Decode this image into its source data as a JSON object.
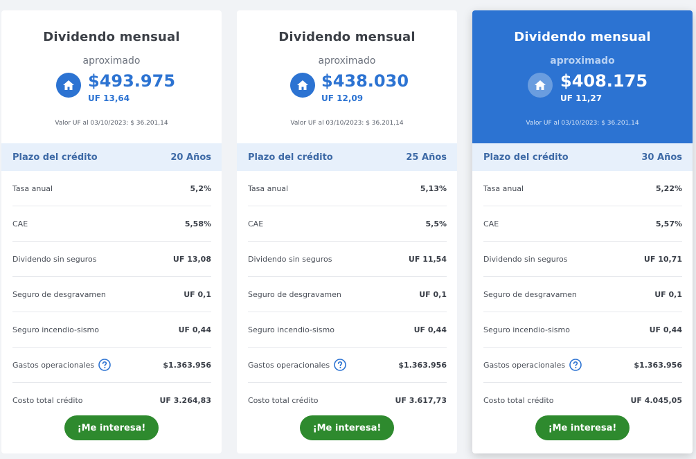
{
  "cards": [
    {
      "title": "Dividendo mensual",
      "subtitle": "aproximado",
      "amount": "$493.975",
      "amount_uf": "UF 13,64",
      "uf_note": "Valor UF al 03/10/2023: $ 36.201,14",
      "plazo_label": "Plazo del crédito",
      "plazo_value": "20 Años",
      "rows": [
        {
          "label": "Tasa anual",
          "value": "5,2%"
        },
        {
          "label": "CAE",
          "value": "5,58%"
        },
        {
          "label": "Dividendo sin seguros",
          "value": "UF 13,08"
        },
        {
          "label": "Seguro de desgravamen",
          "value": "UF 0,1"
        },
        {
          "label": "Seguro incendio-sismo",
          "value": "UF 0,44"
        },
        {
          "label": "Gastos operacionales",
          "value": "$1.363.956"
        },
        {
          "label": "Costo total crédito",
          "value": "UF 3.264,83"
        }
      ],
      "cta": "¡Me interesa!"
    },
    {
      "title": "Dividendo mensual",
      "subtitle": "aproximado",
      "amount": "$438.030",
      "amount_uf": "UF 12,09",
      "uf_note": "Valor UF al 03/10/2023: $ 36.201,14",
      "plazo_label": "Plazo del crédito",
      "plazo_value": "25 Años",
      "rows": [
        {
          "label": "Tasa anual",
          "value": "5,13%"
        },
        {
          "label": "CAE",
          "value": "5,5%"
        },
        {
          "label": "Dividendo sin seguros",
          "value": "UF 11,54"
        },
        {
          "label": "Seguro de desgravamen",
          "value": "UF 0,1"
        },
        {
          "label": "Seguro incendio-sismo",
          "value": "UF 0,44"
        },
        {
          "label": "Gastos operacionales",
          "value": "$1.363.956"
        },
        {
          "label": "Costo total crédito",
          "value": "UF 3.617,73"
        }
      ],
      "cta": "¡Me interesa!"
    },
    {
      "title": "Dividendo mensual",
      "subtitle": "aproximado",
      "amount": "$408.175",
      "amount_uf": "UF 11,27",
      "uf_note": "Valor UF al 03/10/2023: $ 36.201,14",
      "plazo_label": "Plazo del crédito",
      "plazo_value": "30 Años",
      "rows": [
        {
          "label": "Tasa anual",
          "value": "5,22%"
        },
        {
          "label": "CAE",
          "value": "5,57%"
        },
        {
          "label": "Dividendo sin seguros",
          "value": "UF 10,71"
        },
        {
          "label": "Seguro de desgravamen",
          "value": "UF 0,1"
        },
        {
          "label": "Seguro incendio-sismo",
          "value": "UF 0,44"
        },
        {
          "label": "Gastos operacionales",
          "value": "$1.363.956"
        },
        {
          "label": "Costo total crédito",
          "value": "UF 4.045,05"
        }
      ],
      "cta": "¡Me interesa!"
    }
  ],
  "icons": {
    "house": "house-icon",
    "help": "help-circle-icon"
  },
  "colors": {
    "primary_blue": "#2c73d2",
    "cta_green": "#2e8a2e",
    "plazo_bg": "#e7f0fb"
  }
}
